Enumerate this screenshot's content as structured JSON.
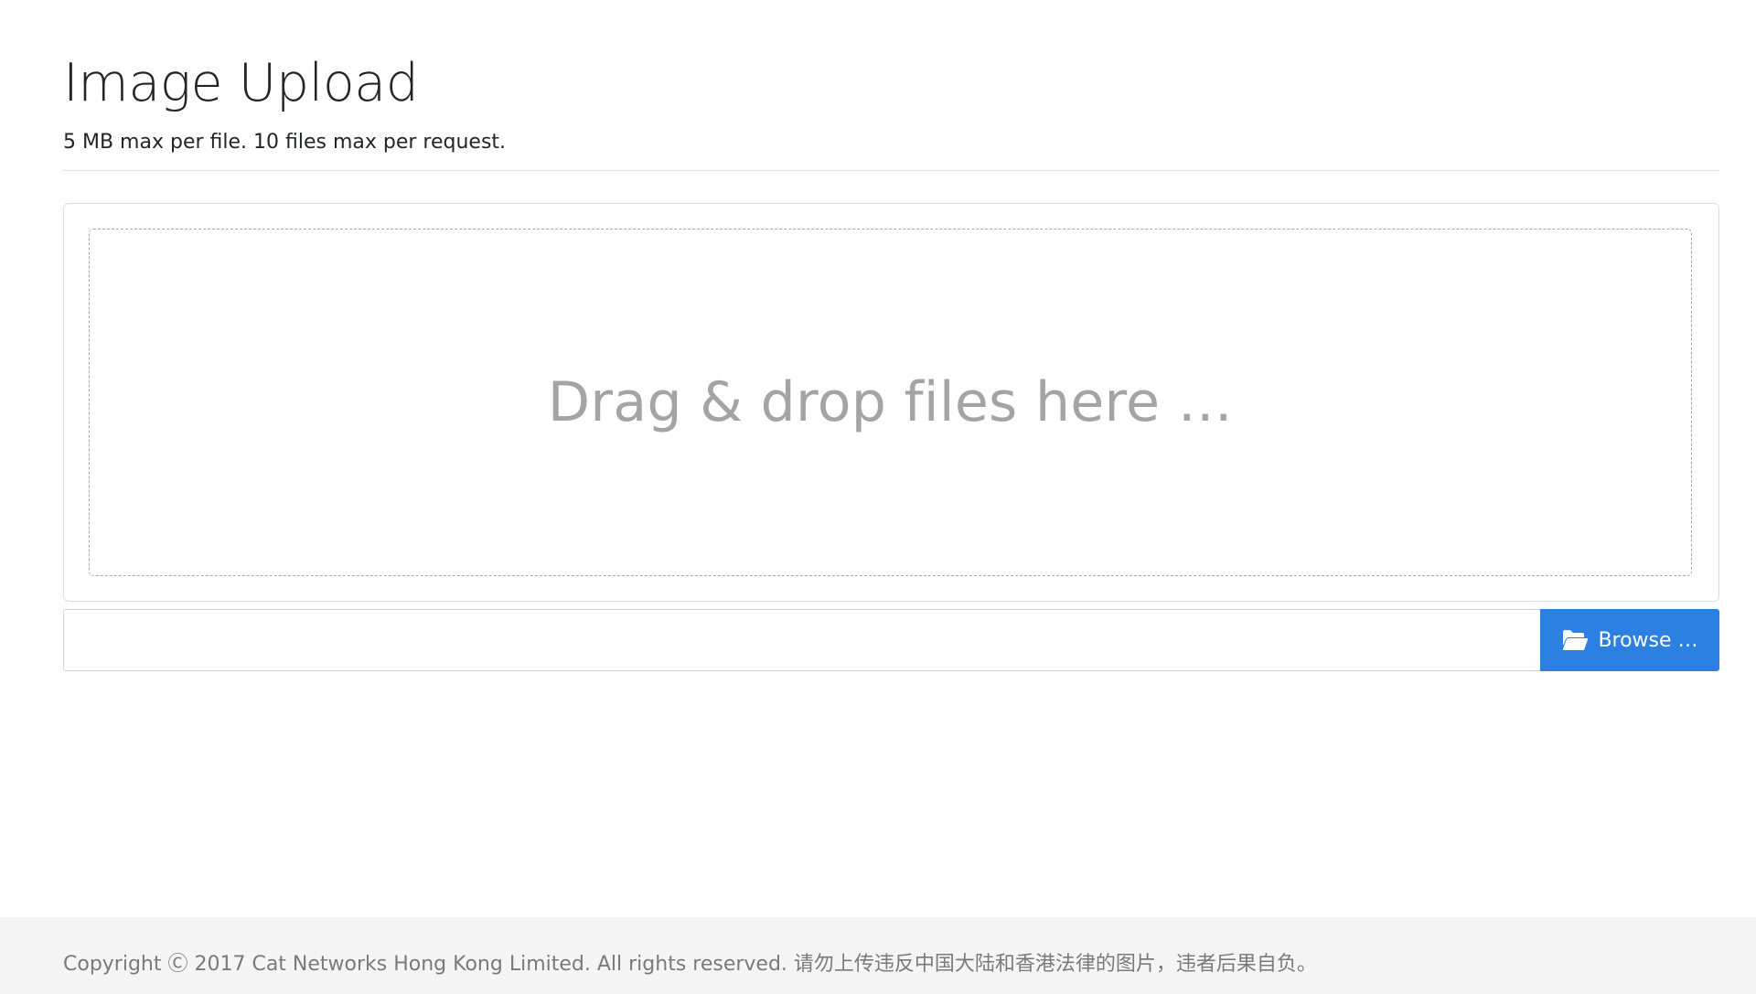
{
  "header": {
    "title": "Image Upload",
    "subtitle": "5 MB max per file. 10 files max per request."
  },
  "upload": {
    "drop_text": "Drag & drop files here …",
    "caption_value": "",
    "browse_label": "Browse …",
    "browse_icon": "folder-open-icon",
    "accent_color": "#2c80e2"
  },
  "footer": {
    "copyright": "Copyright Ⓒ 2017 Cat Networks Hong Kong Limited. All rights reserved. 请勿上传违反中国大陆和香港法律的图片，违者后果自负。"
  }
}
